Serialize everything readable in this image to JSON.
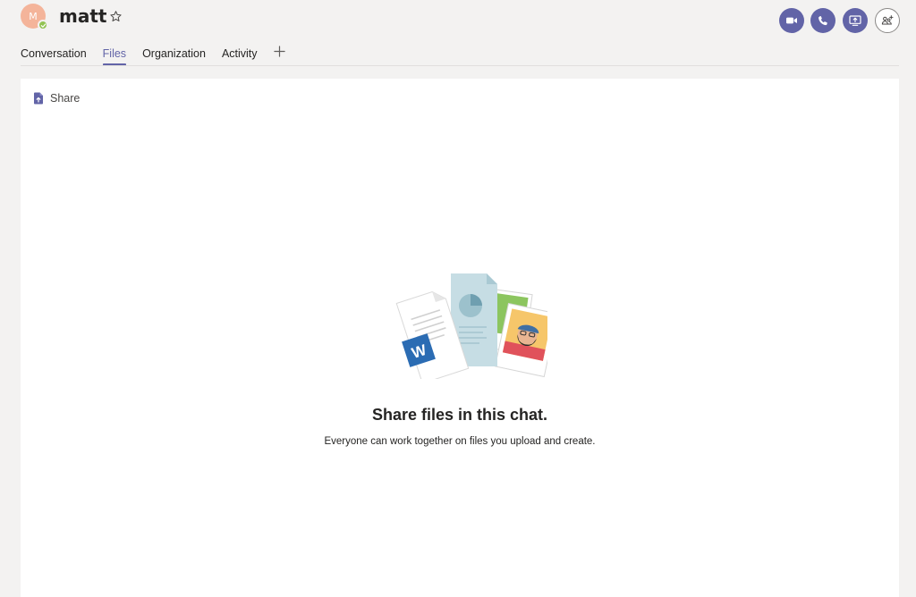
{
  "header": {
    "avatar_initial": "M",
    "contact_name": "matt",
    "actions": [
      {
        "name": "video-call",
        "icon": "video-camera-icon"
      },
      {
        "name": "audio-call",
        "icon": "phone-icon"
      },
      {
        "name": "share-screen",
        "icon": "screen-share-icon"
      },
      {
        "name": "add-people",
        "icon": "add-people-icon"
      }
    ]
  },
  "tabs": [
    {
      "label": "Conversation",
      "active": false
    },
    {
      "label": "Files",
      "active": true
    },
    {
      "label": "Organization",
      "active": false
    },
    {
      "label": "Activity",
      "active": false
    }
  ],
  "files": {
    "share_label": "Share",
    "empty_title": "Share files in this chat.",
    "empty_subtitle": "Everyone can work together on files you upload and create."
  },
  "colors": {
    "accent": "#6264a7",
    "presence_available": "#92c353",
    "avatar_bg": "#f4b49a",
    "background": "#f3f2f1",
    "panel": "#ffffff"
  }
}
